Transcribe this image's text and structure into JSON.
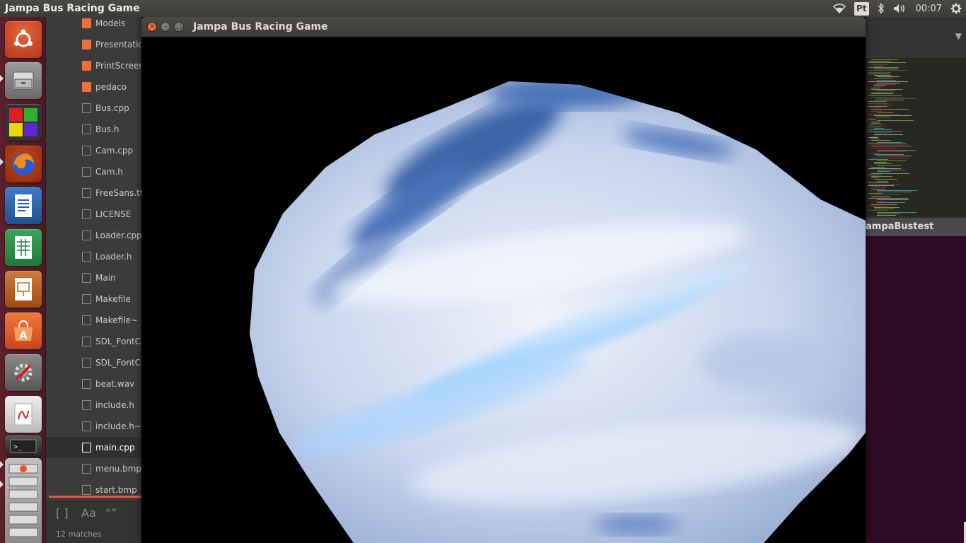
{
  "top_panel": {
    "app_title": "Jampa Bus Racing Game",
    "keyboard_layout": "Pt",
    "clock": "00:07",
    "icons": [
      "wifi-icon",
      "bluetooth-icon",
      "volume-icon",
      "session-gear-icon"
    ]
  },
  "launcher": {
    "items": [
      {
        "name": "ubuntu-dash-icon",
        "color": "#dd4814"
      },
      {
        "name": "files-icon",
        "color": "#8a8a8a"
      },
      {
        "name": "workspaces-icon",
        "color": "#cc0000"
      },
      {
        "name": "firefox-icon",
        "color": "#e66000"
      },
      {
        "name": "libreoffice-writer-icon",
        "color": "#2a6099"
      },
      {
        "name": "libreoffice-calc-icon",
        "color": "#1e8449"
      },
      {
        "name": "libreoffice-impress-icon",
        "color": "#c0662b"
      },
      {
        "name": "software-center-icon",
        "color": "#e95420"
      },
      {
        "name": "system-settings-icon",
        "color": "#777777"
      },
      {
        "name": "document-viewer-icon",
        "color": "#d8d8d8"
      },
      {
        "name": "terminal-icon",
        "color": "#2c2c2c"
      },
      {
        "name": "stacked-apps-icon",
        "color": "#a0a0a0"
      }
    ]
  },
  "file_manager": {
    "files": [
      {
        "name": "Models",
        "type": "folder"
      },
      {
        "name": "Presentatio",
        "type": "folder"
      },
      {
        "name": "PrintScreen",
        "type": "folder"
      },
      {
        "name": "pedaco",
        "type": "folder"
      },
      {
        "name": "Bus.cpp",
        "type": "code"
      },
      {
        "name": "Bus.h",
        "type": "file"
      },
      {
        "name": "Cam.cpp",
        "type": "code"
      },
      {
        "name": "Cam.h",
        "type": "file"
      },
      {
        "name": "FreeSans.tt",
        "type": "font"
      },
      {
        "name": "LICENSE",
        "type": "file"
      },
      {
        "name": "Loader.cpp",
        "type": "code"
      },
      {
        "name": "Loader.h",
        "type": "file"
      },
      {
        "name": "Main",
        "type": "file"
      },
      {
        "name": "Makefile",
        "type": "file"
      },
      {
        "name": "Makefile~",
        "type": "file"
      },
      {
        "name": "SDL_FontCa",
        "type": "code"
      },
      {
        "name": "SDL_FontCa",
        "type": "file"
      },
      {
        "name": "beat.wav",
        "type": "file"
      },
      {
        "name": "include.h",
        "type": "file"
      },
      {
        "name": "include.h~",
        "type": "file"
      },
      {
        "name": "main.cpp",
        "type": "code",
        "selected": true
      },
      {
        "name": "menu.bmp",
        "type": "image"
      },
      {
        "name": "start.bmp",
        "type": "image"
      }
    ],
    "find_tools": [
      "[ ]",
      "Aa",
      "“”"
    ],
    "matches_label": "12 matches"
  },
  "right_area": {
    "terminal_title": "ampaBustest"
  },
  "game_window": {
    "title": "Jampa Bus Racing Game",
    "close_glyph": "×",
    "minimize_glyph": "–",
    "maximize_glyph": "□",
    "colors": {
      "sky_dark": "#3d65a8",
      "sky_mid": "#b8c8e8",
      "cloud_white": "#eef2fa",
      "sky_light": "#a8d4ff"
    }
  }
}
